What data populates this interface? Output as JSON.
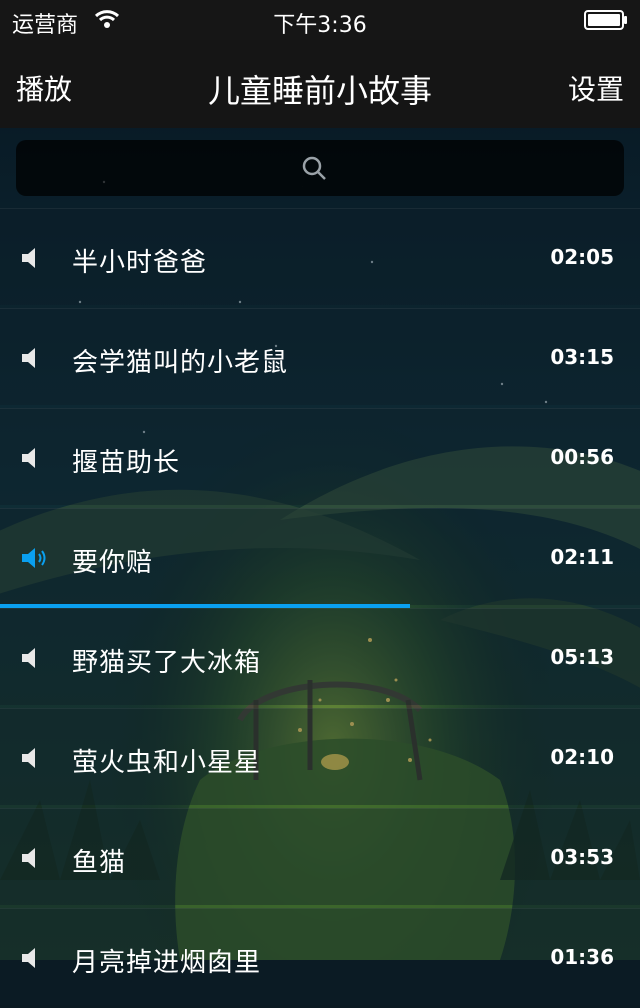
{
  "status": {
    "carrier": "运营商",
    "time": "下午3:36"
  },
  "nav": {
    "left_label": "播放",
    "title": "儿童睡前小故事",
    "right_label": "设置"
  },
  "search": {
    "placeholder": ""
  },
  "stories": [
    {
      "title": "半小时爸爸",
      "duration": "02:05",
      "playing": false
    },
    {
      "title": "会学猫叫的小老鼠",
      "duration": "03:15",
      "playing": false
    },
    {
      "title": "揠苗助长",
      "duration": "00:56",
      "playing": false
    },
    {
      "title": "要你赔",
      "duration": "02:11",
      "playing": true,
      "progress": 0.64
    },
    {
      "title": "野猫买了大冰箱",
      "duration": "05:13",
      "playing": false
    },
    {
      "title": "萤火虫和小星星",
      "duration": "02:10",
      "playing": false
    },
    {
      "title": "鱼猫",
      "duration": "03:53",
      "playing": false
    },
    {
      "title": "月亮掉进烟囱里",
      "duration": "01:36",
      "playing": false
    }
  ],
  "colors": {
    "accent": "#0aa0f0",
    "bar": "#151515"
  },
  "icons": {
    "wifi": "wifi-icon",
    "battery": "battery-icon",
    "search": "search-icon",
    "speaker": "speaker-icon",
    "speaker_playing": "speaker-playing-icon"
  }
}
